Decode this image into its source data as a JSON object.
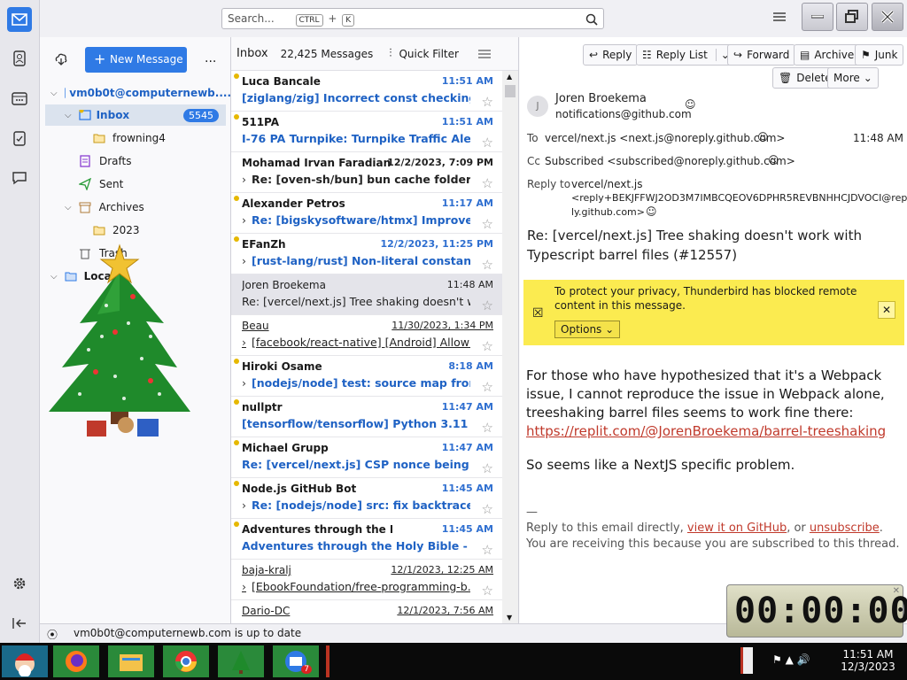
{
  "search": {
    "placeholder": "Search...",
    "key1": "CTRL",
    "plus": "+",
    "key2": "K"
  },
  "folder_pane": {
    "new_message": "New Message",
    "more": "...",
    "account": "vm0b0t@computernewb....",
    "folders": [
      {
        "label": "Inbox",
        "count": "5545"
      },
      {
        "label": "frowning4"
      },
      {
        "label": "Drafts"
      },
      {
        "label": "Sent"
      },
      {
        "label": "Archives"
      },
      {
        "label": "2023"
      },
      {
        "label": "Trash"
      },
      {
        "label": "Local"
      }
    ]
  },
  "thread_pane": {
    "title": "Inbox",
    "count": "22,425 Messages",
    "quick_filter": "Quick Filter",
    "rows": [
      {
        "sender": "Luca Bancale",
        "date": "11:51 AM",
        "subject": "[ziglang/zig] Incorrect const checking i...",
        "unread": true,
        "dot": true,
        "reply": false
      },
      {
        "sender": "511PA",
        "date": "11:51 AM",
        "subject": "I-76 PA Turnpike: Turnpike Traffic Alert ...",
        "unread": true,
        "dot": true,
        "reply": false
      },
      {
        "sender": "Mohamad Irvan Faradian",
        "date": "12/2/2023, 7:09 PM",
        "subject": "Re: [oven-sh/bun] bun cache folder g...",
        "unread": true,
        "dot": false,
        "reply": true,
        "dark": true
      },
      {
        "sender": "Alexander Petros",
        "date": "11:17 AM",
        "subject": "Re: [bigskysoftware/htmx] Improve p...",
        "unread": true,
        "dot": true,
        "reply": true
      },
      {
        "sender": "EFanZh",
        "date": "12/2/2023, 11:25 PM",
        "subject": "[rust-lang/rust] Non-literal constant ...",
        "unread": true,
        "dot": true,
        "reply": true
      },
      {
        "sender": "Joren Broekema",
        "date": "11:48 AM",
        "subject": "Re: [vercel/next.js] Tree shaking doesn't wo...",
        "unread": false,
        "dot": false,
        "reply": false,
        "selected": true
      },
      {
        "sender": "Beau",
        "date": "11/30/2023, 1:34 PM",
        "subject": "[facebook/react-native] [Android] Allow ...",
        "unread": false,
        "dot": false,
        "reply": true,
        "underline": true
      },
      {
        "sender": "Hiroki Osame",
        "date": "8:18 AM",
        "subject": "[nodejs/node] test: source map from ...",
        "unread": true,
        "dot": true,
        "reply": true
      },
      {
        "sender": "nullptr",
        "date": "11:47 AM",
        "subject": "[tensorflow/tensorflow] Python 3.11 TF...",
        "unread": true,
        "dot": true,
        "reply": false
      },
      {
        "sender": "Michael Grupp",
        "date": "11:47 AM",
        "subject": "Re: [vercel/next.js] CSP nonce being ad...",
        "unread": true,
        "dot": true,
        "reply": false
      },
      {
        "sender": "Node.js GitHub Bot",
        "date": "11:45 AM",
        "subject": "Re: [nodejs/node] src: fix backtrace w...",
        "unread": true,
        "dot": true,
        "reply": true
      },
      {
        "sender": "Adventures through the Holy Bible",
        "date": "11:45 AM",
        "subject": "Adventures through the Holy Bible - W...",
        "unread": true,
        "dot": true,
        "reply": false
      },
      {
        "sender": "baja-kralj",
        "date": "12/1/2023, 12:25 AM",
        "subject": "[EbookFoundation/free-programming-b...",
        "unread": false,
        "dot": false,
        "reply": true,
        "underline": true
      },
      {
        "sender": "Dario-DC",
        "date": "12/1/2023, 7:56 AM",
        "subject": "",
        "unread": false,
        "dot": false,
        "reply": false,
        "underline": true
      }
    ]
  },
  "message": {
    "buttons": {
      "reply": "Reply",
      "reply_list": "Reply List",
      "forward": "Forward",
      "archive": "Archive",
      "junk": "Junk",
      "delete": "Delete",
      "more": "More"
    },
    "from_name": "Joren Broekema",
    "from_email": "notifications@github.com",
    "to_label": "To",
    "to_value": "vercel/next.js <next.js@noreply.github.com>",
    "time": "11:48 AM",
    "cc_label": "Cc",
    "cc_value": "Subscribed <subscribed@noreply.github.com>",
    "replyto_label": "Reply to",
    "replyto_l1": "vercel/next.js",
    "replyto_l2": "<reply+BEKJFFWJ2OD3M7IMBCQEOV6DPHR5REVBNHHCJDVOCI@rep",
    "replyto_l3": "ly.github.com>",
    "subject_l1": "Re: [vercel/next.js] Tree shaking doesn't work with",
    "subject_l2": "Typescript barrel files (#12557)",
    "notice_l1": "To protect your privacy, Thunderbird has blocked remote",
    "notice_l2": "content in this message.",
    "options": "Options",
    "body_text": "For those who have hypothesized that it's a Webpack issue, I cannot reproduce the issue in Webpack alone, treeshaking barrel files seems to work fine there: ",
    "body_link": "https://replit.com/@JorenBroekema/barrel-treeshaking",
    "body_p2": "So seems like a NextJS specific problem.",
    "sig": "—",
    "foot_1a": "Reply to this email directly, ",
    "foot_link1": "view it on GitHub",
    "foot_1b": ", or ",
    "foot_link2": "unsubscribe",
    "foot_1c": ".",
    "foot_2": "You are receiving this because you are subscribed to this thread."
  },
  "status": {
    "text": "vm0b0t@computernewb.com is up to date"
  },
  "clock_widget": {
    "time": "00:00:00"
  },
  "taskbar": {
    "time": "11:51 AM",
    "date": "12/3/2023",
    "badge": "7"
  },
  "colors": {
    "accent": "#2f7ae5",
    "notice": "#fbeb50",
    "unread_blue": "#1f62c4",
    "star_dot": "#e6b800"
  }
}
